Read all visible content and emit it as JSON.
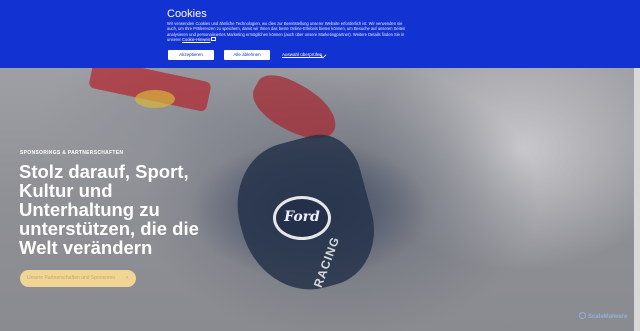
{
  "cookie_banner": {
    "title": "Cookies",
    "body": "Wir verwenden Cookies und ähnliche Technologien, wo dies zur Bereitstellung unserer Website erforderlich ist. Wir verwenden sie auch, um Ihre Präferenzen zu speichern, damit wir Ihnen das beste Online-Erlebnis bieten können, um Besuche auf unseren Seiten analysieren und personalisiertes Marketing ermöglichen können (auch über unsere Marketingpartner). Weitere Details finden Sie in unserer",
    "link_label": "Cookie-Hinweis",
    "accept_label": "Akzeptieren",
    "reject_label": "Alle ablehnen",
    "select_label": "Auswahl überprüfen"
  },
  "hero": {
    "eyebrow": "SPONSORINGS & PARTNERSCHAFTEN",
    "headline": "Stolz darauf, Sport, Kultur und Unterhaltung zu unterstützen, die die Welt verändern",
    "cta_label": "Unsere Partnerschaften und Sponsoren",
    "ford_logo_text": "Ford",
    "racing_text": "RACING"
  },
  "footer": {
    "brand_label": "ScaleMalware"
  }
}
